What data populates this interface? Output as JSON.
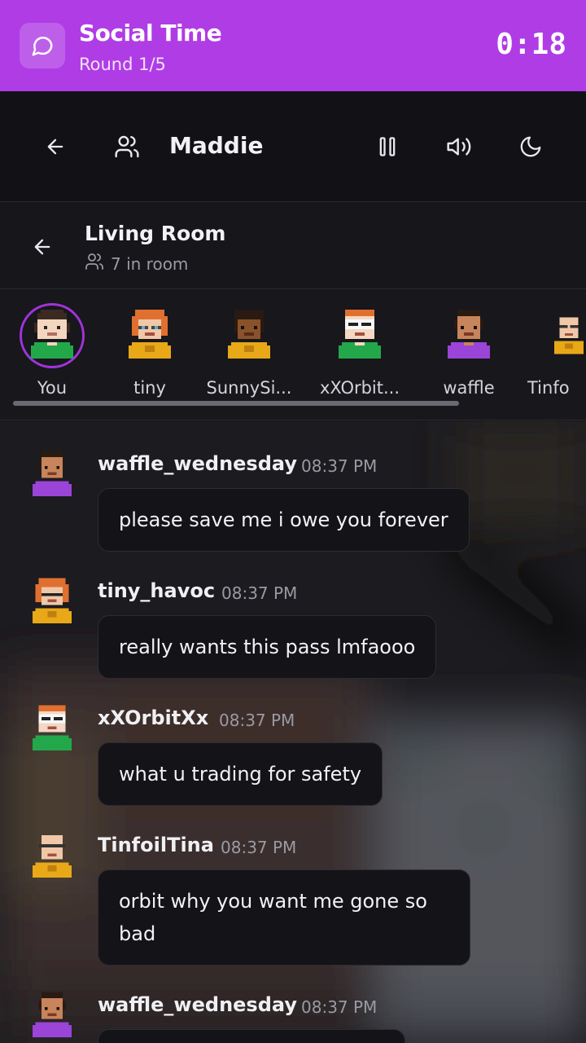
{
  "banner": {
    "title": "Social Time",
    "subtitle": "Round 1/5",
    "timer": "0:18",
    "icon": "chat-bubble-icon",
    "color": "#b03ce6"
  },
  "header": {
    "name": "Maddie",
    "icons": [
      "back-arrow-icon",
      "users-icon",
      "pause-icon",
      "volume-icon",
      "moon-icon"
    ]
  },
  "room": {
    "title": "Living Room",
    "count": "7 in room",
    "icons": [
      "back-arrow-icon",
      "users-icon"
    ]
  },
  "members": [
    {
      "name": "You",
      "selected": true
    },
    {
      "name": "tiny"
    },
    {
      "name": "SunnySi..."
    },
    {
      "name": "xXOrbit..."
    },
    {
      "name": "waffle"
    },
    {
      "name": "Tinfo"
    }
  ],
  "messages": [
    {
      "user": "waffle_wednesday",
      "time": "08:37 PM",
      "text": "please save me i owe you forever"
    },
    {
      "user": "tiny_havoc",
      "time": "08:37 PM",
      "text": "really wants this pass lmfaooo"
    },
    {
      "user": "xXOrbitXx",
      "time": "08:37 PM",
      "text": "what u trading for safety"
    },
    {
      "user": "TinfoilTina",
      "time": "08:37 PM",
      "text": "orbit why you want me gone so bad"
    },
    {
      "user": "waffle_wednesday",
      "time": "08:37 PM",
      "text": ""
    }
  ]
}
